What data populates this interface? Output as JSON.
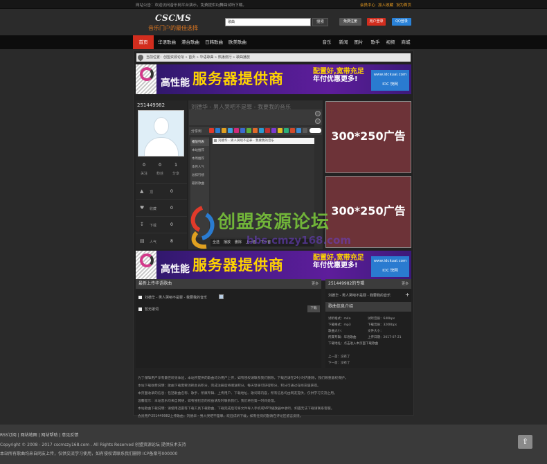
{
  "topbar": {
    "left_text": "网站公告：欢迎访问音乐网平台演示，免费提供DJ舞曲试听下载。",
    "links": [
      "会员中心",
      "加入收藏",
      "设为首页"
    ],
    "colors": {
      "links": "#f0a020"
    }
  },
  "header": {
    "logo": "CSCMS",
    "slogan": "音乐门户的最佳选择",
    "search_placeholder": "歌曲",
    "search_button": "搜索",
    "btn_login": "免费注册",
    "btn_register": "用户登录",
    "btn_qq": "QQ登录"
  },
  "nav": {
    "left": [
      "首页",
      "华语歌曲",
      "港台歌曲",
      "日韩歌曲",
      "欧美歌曲"
    ],
    "right": [
      "音乐",
      "新闻",
      "图片",
      "歌手",
      "视频",
      "商城"
    ],
    "active_color": "#d22d1e"
  },
  "breadcrumb": "当前位置：创盟资源论坛 » 首页 » 华语歌曲 » 热播流行 » 歌曲播放",
  "banner": {
    "prefix": "高性能",
    "main": "服务器提供商",
    "side_line1": "配置好,宽带充足",
    "side_line2": "年付优惠更多!",
    "site": "www.idckuai.com",
    "brand": "IDC 快网"
  },
  "user": {
    "id": "251449982",
    "stats": [
      {
        "value": "0",
        "label": "关注"
      },
      {
        "value": "0",
        "label": "粉丝"
      },
      {
        "value": "1",
        "label": "分享"
      }
    ],
    "rows": [
      {
        "icon": "thumb-up-icon",
        "label": "顶",
        "value": "0"
      },
      {
        "icon": "heart-icon",
        "label": "收藏",
        "value": "0"
      },
      {
        "icon": "download-icon",
        "label": "下载",
        "value": "0"
      },
      {
        "icon": "chart-icon",
        "label": "人气",
        "value": "8"
      }
    ]
  },
  "player": {
    "title": "刘德华 - 男人哭吧不是罪 - 我要我的音乐",
    "toolbar_label": "分享到",
    "sidebar": [
      "播放列表",
      "本站推荐",
      "本周推荐",
      "本月人气",
      "总排行榜",
      "最新歌曲"
    ],
    "playlist_row": "刘德华 - 男人哭吧不是罪 - 我要我的音乐",
    "bottom": [
      "全选",
      "播放",
      "删除",
      "上一首",
      "下一首"
    ]
  },
  "ads": [
    "300*250广告位",
    "300*250广告位"
  ],
  "latest_section": {
    "title": "最新上传华语歌曲",
    "more": "更多",
    "items": [
      "刘德华 - 男人哭吧不是罪 - 我要我的音乐",
      "暂无歌词"
    ],
    "download_btn": "下载"
  },
  "album_section": {
    "title": "251449982的专辑",
    "more": "更多",
    "item": "刘德华 - 男人哭吧不是罪 - 我要我的音乐",
    "info_title": "歌曲信息介绍",
    "info": [
      [
        "试听格式：m4a",
        "试听音质：64Kbps"
      ],
      [
        "下载格式：mp3",
        "下载音质：320Kbps"
      ],
      [
        "歌曲大小：",
        "文件大小："
      ],
      [
        "所属专辑：华语歌曲",
        "上传日期：2017-07-21"
      ],
      [
        "下载地址：点击进入本页面下载歌曲",
        ""
      ]
    ],
    "prev": "上一首：没有了",
    "next": "下一首：没有了"
  },
  "paragraphs": [
    "为了保障用户享有最佳听觉体验，本站所提供的歌曲均为用户上传，如有侵权请联系我们删除，下载后请在24小时内删除，我们尊重版权保护。",
    "本站下载收费说明：歌曲下载需要消耗会员积分，完成注册后将赠送积分，每天登录可获得积分，积分可通过在线充值获得。",
    "本页面收录的信息：包括歌曲名称、歌手、所属专辑、上传用户、下载地址、歌词等内容，所有信息均由网友提供，仅供学习交流之用。",
    "温馨提示：本站音乐均来自网络，如有侵犯您的权益请及时联系我们，我们将在第一时间处理。",
    "本站歌曲下载说明：请使用迅雷等下载工具下载歌曲，下载完成后可将文件导入手机或MP3播放器中收听，如遇无法下载请联系客服。",
    "会员用户251449982上传歌曲：刘德华 - 男人哭吧不是罪，欢迎试听下载，如有任何问题请在评论区留言反馈。"
  ],
  "footer": {
    "links": "RSS订阅 | 网站地图 | 网站帮助 | 意见反馈",
    "copyright": "Copyright © 2008 - 2017 cscmszy168.com . All Rights Reserved 创盟资源论坛 提供技术支持",
    "note": "本站所有歌曲均来自网友上传，仅供交流学习使用，如有侵权请联系我们删除 ICP备案号000000",
    "back_top_icon": "arrow-up-icon"
  },
  "watermark": {
    "text": "创盟资源论坛",
    "url": "bbs.cmzy168.com"
  }
}
